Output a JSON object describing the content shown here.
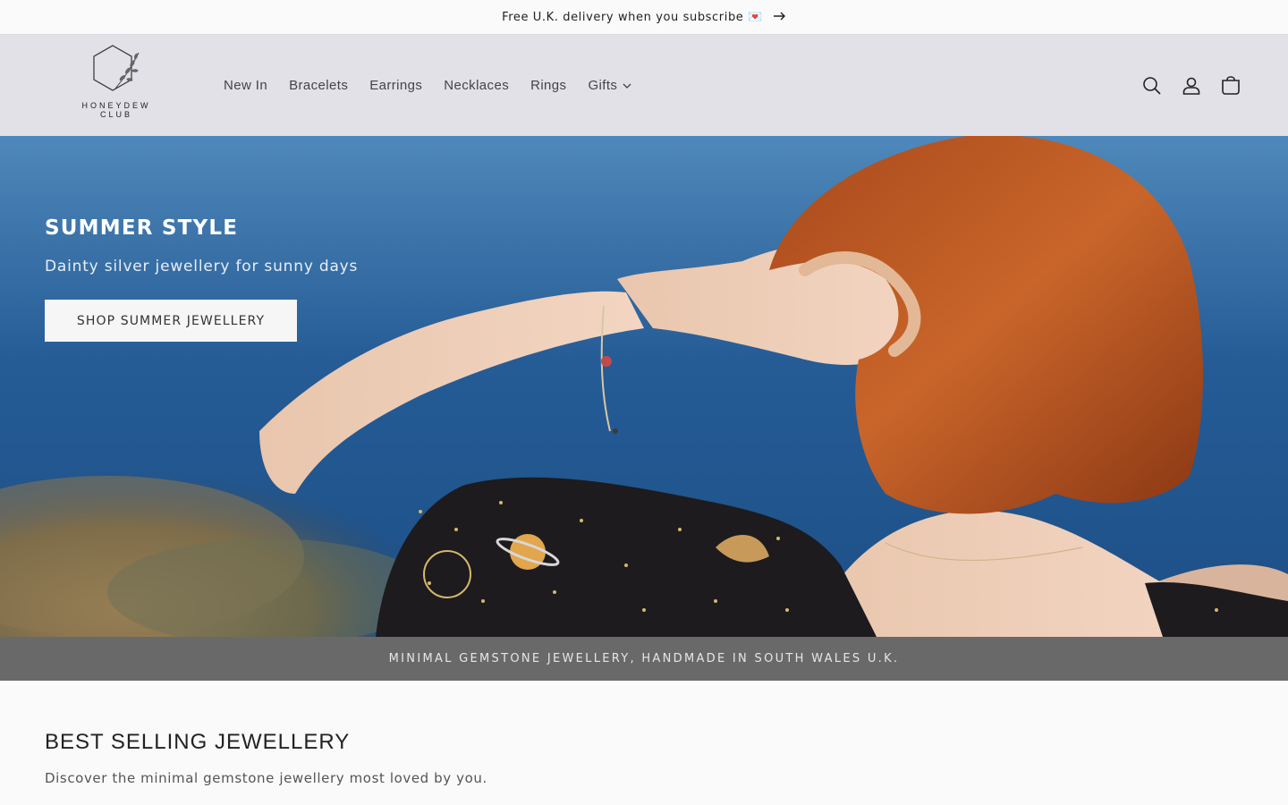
{
  "announcement": {
    "text": "Free U.K. delivery when you subscribe 💌",
    "arrow_icon": "arrow-right-icon"
  },
  "header": {
    "logo_text_line1": "HONEYDEW",
    "logo_text_line2": "CLUB",
    "nav": [
      {
        "label": "New In"
      },
      {
        "label": "Bracelets"
      },
      {
        "label": "Earrings"
      },
      {
        "label": "Necklaces"
      },
      {
        "label": "Rings"
      },
      {
        "label": "Gifts",
        "icon": "chevron-down-icon"
      }
    ],
    "icons": [
      "search-icon",
      "account-icon",
      "cart-icon"
    ]
  },
  "hero": {
    "title": "SUMMER STYLE",
    "subtitle": "Dainty silver jewellery for sunny days",
    "cta": "SHOP SUMMER JEWELLERY"
  },
  "strip": {
    "text": "MINIMAL GEMSTONE JEWELLERY, HANDMADE IN SOUTH WALES U.K."
  },
  "best_sellers": {
    "title": "BEST SELLING JEWELLERY",
    "description": "Discover the minimal gemstone jewellery most loved by you."
  }
}
